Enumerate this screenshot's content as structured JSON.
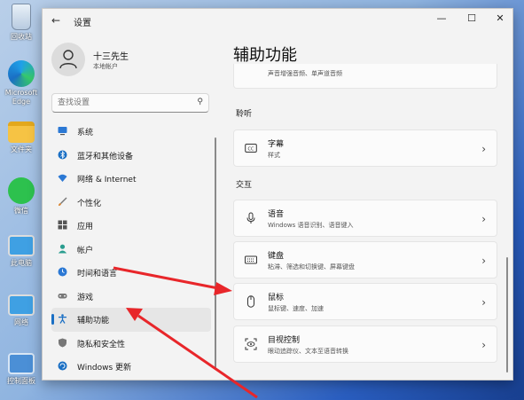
{
  "desktop": {
    "icons": [
      {
        "label": "回收站",
        "name": "recycle-bin"
      },
      {
        "label": "Microsoft Edge",
        "name": "edge"
      },
      {
        "label": "文件夹",
        "name": "folder"
      },
      {
        "label": "微信",
        "name": "wechat"
      },
      {
        "label": "此电脑",
        "name": "this-pc"
      },
      {
        "label": "网络",
        "name": "network"
      },
      {
        "label": "控制面板",
        "name": "control-panel"
      }
    ]
  },
  "window": {
    "title": "设置",
    "back_icon": "arrow-left-icon",
    "controls": {
      "minimize": "—",
      "maximize": "☐",
      "close": "✕"
    }
  },
  "profile": {
    "name": "十三先生",
    "account_type": "本地帐户"
  },
  "search": {
    "placeholder": "查找设置",
    "icon": "search-icon"
  },
  "nav": {
    "items": [
      {
        "label": "系统",
        "icon": "monitor-icon",
        "color": "#2b78d4"
      },
      {
        "label": "蓝牙和其他设备",
        "icon": "bluetooth-icon",
        "color": "#1a6fc4"
      },
      {
        "label": "网络 & Internet",
        "icon": "wifi-icon",
        "color": "#2b78d4"
      },
      {
        "label": "个性化",
        "icon": "brush-icon",
        "color": "#d9822b"
      },
      {
        "label": "应用",
        "icon": "apps-icon",
        "color": "#555555"
      },
      {
        "label": "帐户",
        "icon": "person-icon",
        "color": "#2a9d8f"
      },
      {
        "label": "时间和语言",
        "icon": "globe-clock-icon",
        "color": "#2b78d4"
      },
      {
        "label": "游戏",
        "icon": "gamepad-icon",
        "color": "#666666"
      },
      {
        "label": "辅助功能",
        "icon": "accessibility-icon",
        "color": "#1a6fc4",
        "active": true
      },
      {
        "label": "隐私和安全性",
        "icon": "shield-icon",
        "color": "#666666"
      },
      {
        "label": "Windows 更新",
        "icon": "update-icon",
        "color": "#1a6fc4"
      }
    ]
  },
  "main": {
    "title": "辅助功能",
    "partial_card_sub": "声音增强音频、单声道音频",
    "sections": [
      {
        "heading": "聆听",
        "cards": [
          {
            "title": "字幕",
            "subtitle": "样式",
            "icon": "captions-icon"
          }
        ]
      },
      {
        "heading": "交互",
        "cards": [
          {
            "title": "语音",
            "subtitle": "Windows 语音识别、语音键入",
            "icon": "microphone-icon"
          },
          {
            "title": "键盘",
            "subtitle": "粘滞、筛选和切换键、屏幕键盘",
            "icon": "keyboard-icon"
          },
          {
            "title": "鼠标",
            "subtitle": "鼠标键、速度、加速",
            "icon": "mouse-icon"
          },
          {
            "title": "目视控制",
            "subtitle": "眼动追踪仪、文本至语音转换",
            "icon": "eye-control-icon"
          }
        ]
      }
    ],
    "chevron": "›"
  },
  "annotation": {
    "arrow_color": "#e8262a"
  }
}
